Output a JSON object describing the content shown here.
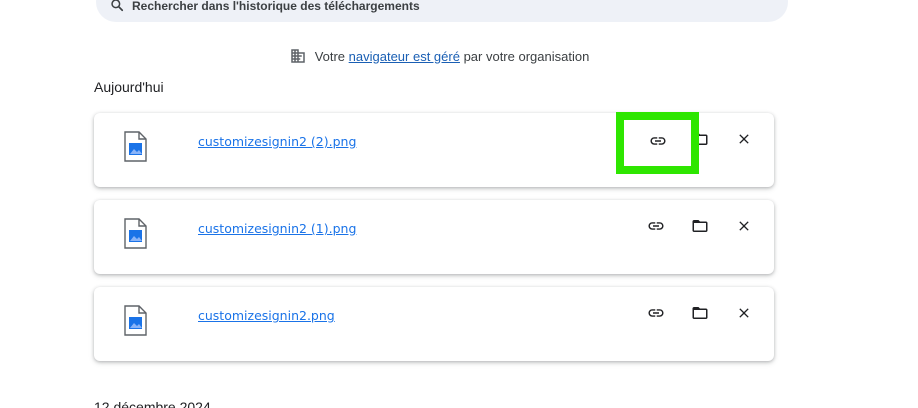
{
  "search": {
    "placeholder": "Rechercher dans l'historique des téléchargements",
    "icon": "search-icon"
  },
  "managed_notice": {
    "prefix": "Votre ",
    "link": "navigateur est géré",
    "suffix": " par votre organisation",
    "icon": "building-icon"
  },
  "sections": [
    {
      "date": "Aujourd'hui"
    },
    {
      "date": "12 décembre 2024"
    }
  ],
  "downloads": [
    {
      "filename": "customizesignin2 (2).png"
    },
    {
      "filename": "customizesignin2 (1).png"
    },
    {
      "filename": "customizesignin2.png"
    }
  ],
  "colors": {
    "link": "#1a73e8",
    "highlight": "#2ee600",
    "search_bg": "#eef1f7"
  }
}
